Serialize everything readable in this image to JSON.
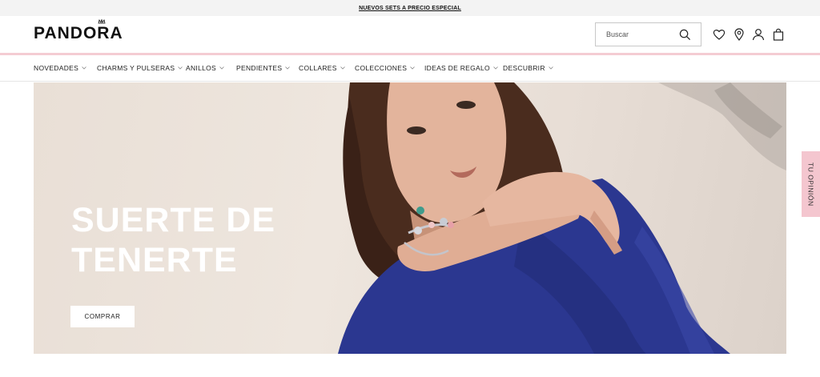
{
  "promo": {
    "text": "NUEVOS SETS A PRECIO ESPECIAL"
  },
  "header": {
    "logo": "PANDORA",
    "search": {
      "placeholder": "Buscar"
    },
    "icons": [
      "search-icon",
      "heart-icon",
      "location-pin-icon",
      "user-icon",
      "bag-icon"
    ]
  },
  "nav": {
    "items": [
      {
        "label": "NOVEDADES",
        "has_dropdown": true
      },
      {
        "label": "CHARMS Y PULSERAS",
        "has_dropdown": true
      },
      {
        "label": "ANILLOS",
        "has_dropdown": true
      },
      {
        "label": "PENDIENTES",
        "has_dropdown": true
      },
      {
        "label": "COLLARES",
        "has_dropdown": true
      },
      {
        "label": "COLECCIONES",
        "has_dropdown": true
      },
      {
        "label": "IDEAS DE REGALO",
        "has_dropdown": true
      },
      {
        "label": "DESCUBRIR",
        "has_dropdown": true
      }
    ]
  },
  "hero": {
    "title_line1": "SUERTE DE",
    "title_line2": "TENERTE",
    "cta": "COMPRAR"
  },
  "feedback": {
    "label": "TU OPINIÓN"
  },
  "colors": {
    "accent_pink": "#f4ccd3",
    "promo_bg": "#f3f3f3",
    "dress_blue": "#2b3790"
  }
}
